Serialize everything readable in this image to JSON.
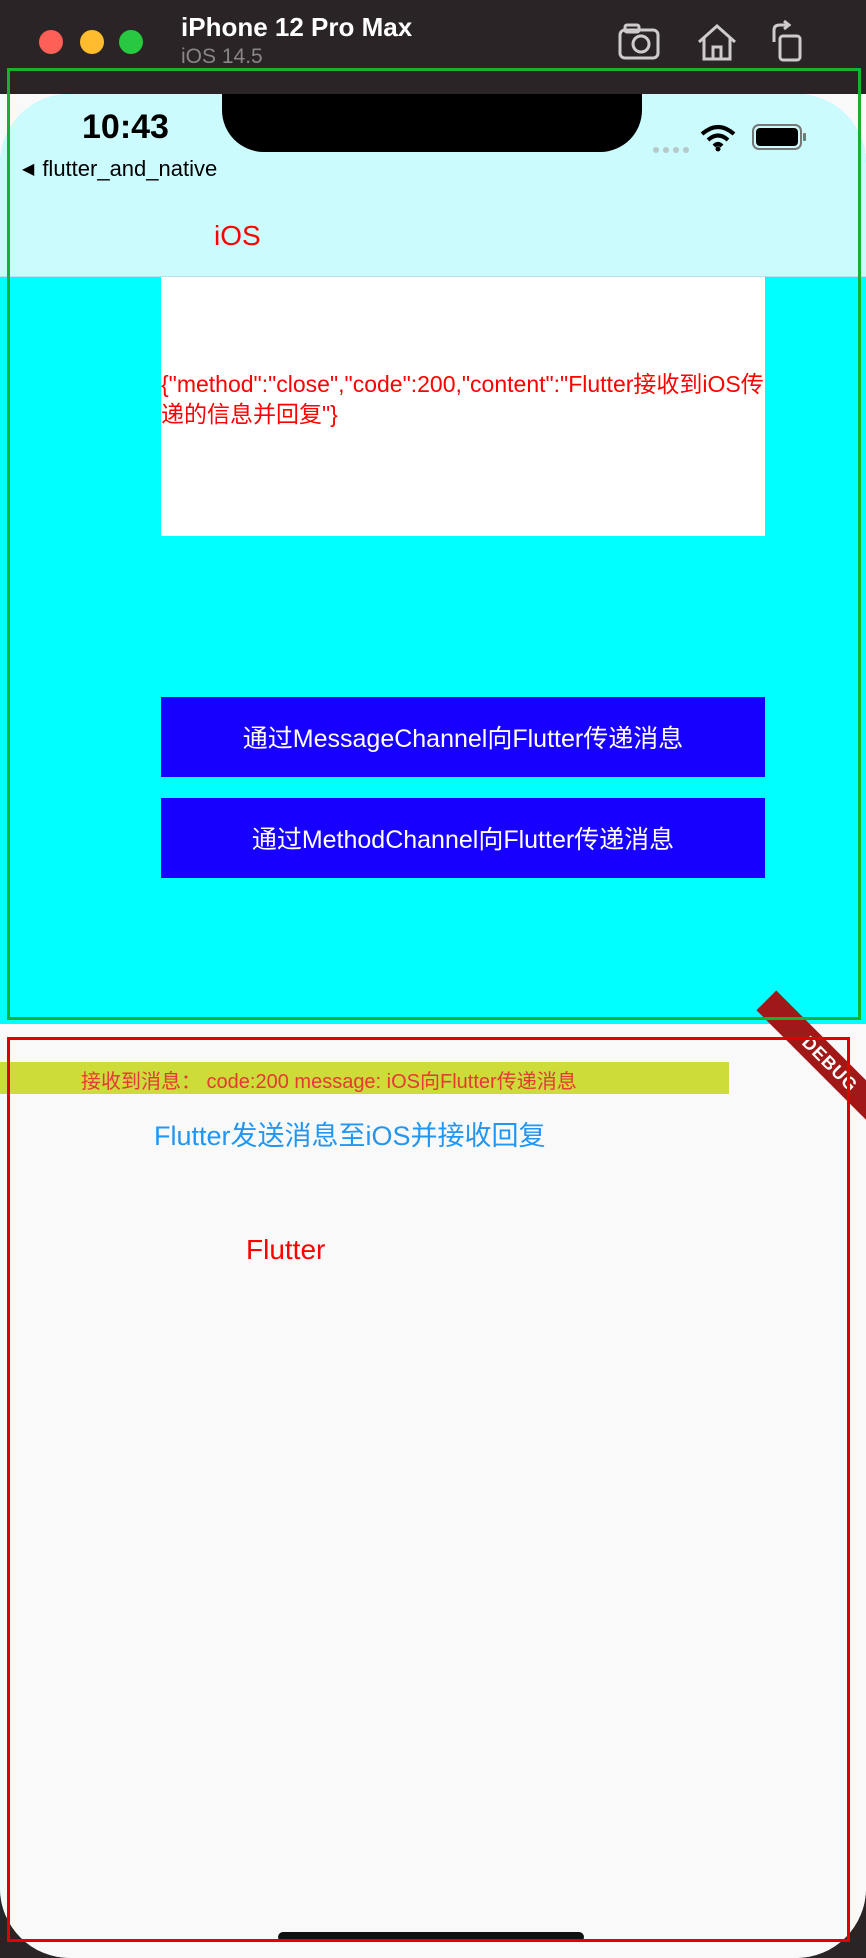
{
  "window": {
    "title": "iPhone 12 Pro Max",
    "subtitle": "iOS 14.5",
    "icons": [
      "camera-icon",
      "home-icon",
      "rotate-icon"
    ]
  },
  "status_bar": {
    "time": "10:43",
    "back_app": "flutter_and_native"
  },
  "ios": {
    "nav_label": "iOS",
    "response": "{\"method\":\"close\",\"code\":200,\"content\":\"Flutter接收到iOS传递的信息并回复\"}",
    "buttons": {
      "message_channel": "通过MessageChannel向Flutter传递消息",
      "method_channel": "通过MethodChannel向Flutter传递消息"
    },
    "colors": {
      "background": "#00ffff",
      "navbar": "#ccfbfe",
      "button": "#1800ff",
      "text": "#ff0000"
    }
  },
  "flutter": {
    "received": "接收到消息：  code:200 message: iOS向Flutter传递消息",
    "send_button": "Flutter发送消息至iOS并接收回复",
    "label": "Flutter",
    "debug_banner": "DEBUG",
    "colors": {
      "received_bar": "#cddc39",
      "send_text": "#2196f3"
    }
  }
}
